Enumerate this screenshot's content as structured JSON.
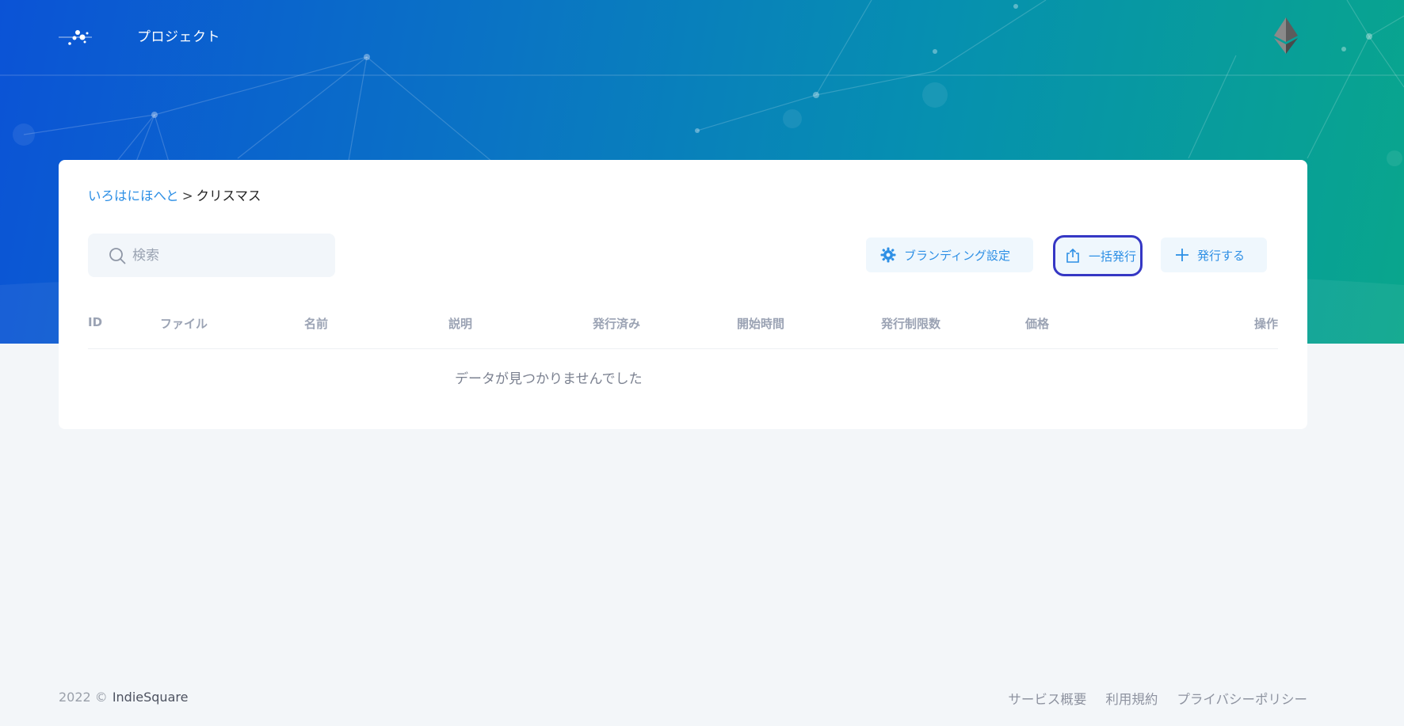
{
  "header": {
    "title": "プロジェクト",
    "logo_icon": "network-dots-logo",
    "network_icon": "ethereum-icon"
  },
  "colors": {
    "hero_gradient_start": "#0b53d6",
    "hero_gradient_end": "#09a68c",
    "link": "#2d8fe5",
    "highlight_border": "#3537c4"
  },
  "breadcrumb": {
    "parent": "いろはにほへと",
    "separator": ">",
    "current": "クリスマス"
  },
  "search": {
    "placeholder": "検索"
  },
  "toolbar": {
    "branding_label": "ブランディング設定",
    "bulk_issue_label": "一括発行",
    "issue_label": "発行する"
  },
  "table": {
    "columns": [
      "ID",
      "ファイル",
      "名前",
      "説明",
      "発行済み",
      "開始時間",
      "発行制限数",
      "価格",
      "操作"
    ],
    "empty_message": "データが見つかりませんでした"
  },
  "footer": {
    "copyright": "2022 ©",
    "brand": "IndieSquare",
    "links": [
      "サービス概要",
      "利用規約",
      "プライバシーポリシー"
    ]
  }
}
